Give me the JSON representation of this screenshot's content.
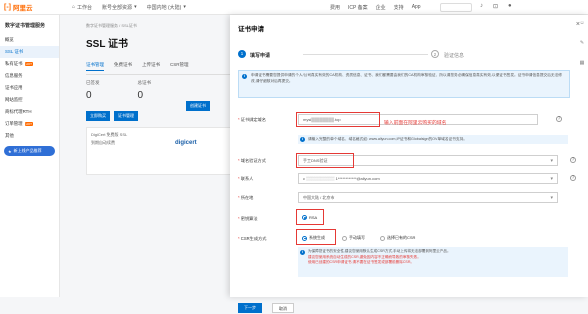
{
  "topbar": {
    "logo_mark": "[-]",
    "logo_text": "阿里云",
    "workbench": "工作台",
    "account": "账号全部资源",
    "region": "中国内地 (大陆)",
    "links": [
      "费用",
      "ICP 备案",
      "企业",
      "支持",
      "App"
    ]
  },
  "sidebar": {
    "title": "数字证书管理服务",
    "items": [
      {
        "label": "概览"
      },
      {
        "label": "SSL 证书"
      },
      {
        "label": "私有证书",
        "badge": "HOT"
      },
      {
        "label": "信息服务"
      },
      {
        "label": "证书应用"
      },
      {
        "label": "网站监控"
      },
      {
        "label": "商标代理RTH"
      },
      {
        "label": "订单管理",
        "badge": "HOT"
      },
      {
        "label": "其他"
      }
    ],
    "pill_label": "新上线产品推荐"
  },
  "main": {
    "breadcrumb": "数字证书管理服务 / SSL证书",
    "title": "SSL 证书",
    "tabs": [
      "证书管理",
      "免费证书",
      "上传证书",
      "CSR管理"
    ],
    "stats": [
      {
        "label": "已签发",
        "value": "0"
      },
      {
        "label": "总证书",
        "value": "0"
      }
    ],
    "buy_button": "创建证书",
    "action_buttons": [
      "立即购买",
      "证书管理"
    ],
    "card_label": "DigiCert 免费版 SSL",
    "card_sub": "到期自动续费",
    "digicert": "digicert"
  },
  "panel": {
    "title": "证书申请",
    "steps": [
      {
        "num": "1",
        "label": "填写申请"
      },
      {
        "num": "2",
        "label": "验证信息"
      }
    ],
    "notice": "申请证书需要您提供申请的个人/公司真实有效的CA机构、资质信息、证书、我们都需要由我们的CA机构审核验证、所以请您务必确保信息真实有效,以便证书签发。证书申请信息提交后无法修改,请仔细核对后再提交。",
    "fields": {
      "domain_label": "证书绑定域名",
      "domain_value": "mysi",
      "domain_suffix": ".top",
      "domain_annotation": "输入前面在阿里云购买的域名",
      "domain_tip": "请输入完整的单个域名、域名格式如: www.aliyun.com,IP证书和Globalsign的OV单域名证书支持。",
      "verify_label": "域名验证方式",
      "verify_value": "手工DNS验证",
      "contact_label": "联系人",
      "contact_value": "c",
      "contact_mask": "1************@aliyun.com",
      "location_label": "所在地",
      "location_value": "中国大陆 / 北京市",
      "algo_label": "密钥算法",
      "algo_option": "RSA",
      "csr_label": "CSR生成方式",
      "csr_options": [
        "系统生成",
        "手动填写",
        "选择已有的CSR"
      ],
      "csr_note_1": "为保障您证书的安全性,建议您使用默认生成CSR方式,手动上传将无法部署到阿里云产品。",
      "csr_note_2": "建议您使用系统自动生成的CSR,避免因内容不正确而导致的审核失败。",
      "csr_note_3": "使用已创建的CSR申请证书,请不要在证书签发或部署前删除CSR。"
    },
    "next_button": "下一步",
    "cancel_button": "取消"
  },
  "colors": {
    "brand": "#ff6a00",
    "primary": "#0070cc",
    "annotation": "#e53935"
  }
}
